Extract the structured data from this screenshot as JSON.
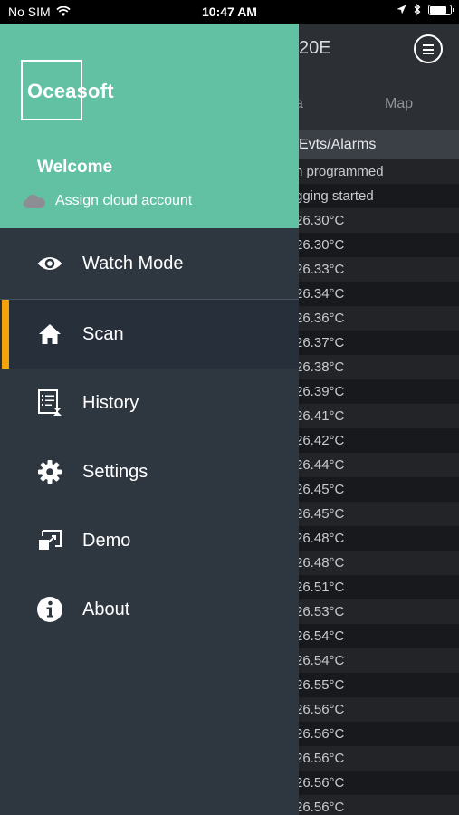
{
  "status_bar": {
    "carrier": "No SIM",
    "time": "10:47 AM",
    "battery_level": 0.85
  },
  "background_app": {
    "title_partial": "20E",
    "tabs": [
      "a",
      "Map"
    ],
    "column_header": "Evts/Alarms",
    "rows": [
      "n programmed",
      "gging started",
      "26.30°C",
      "26.30°C",
      "26.33°C",
      "26.34°C",
      "26.36°C",
      "26.37°C",
      "26.38°C",
      "26.39°C",
      "26.41°C",
      "26.42°C",
      "26.44°C",
      "26.45°C",
      "26.45°C",
      "26.48°C",
      "26.48°C",
      "26.51°C",
      "26.53°C",
      "26.54°C",
      "26.54°C",
      "26.55°C",
      "26.56°C",
      "26.56°C",
      "26.56°C",
      "26.56°C",
      "26.56°C"
    ]
  },
  "drawer": {
    "logo": "Oceasoft",
    "welcome": "Welcome",
    "cloud_link": "Assign cloud account",
    "items": [
      {
        "label": "Watch Mode",
        "icon": "eye-icon"
      },
      {
        "label": "Scan",
        "icon": "home-icon",
        "active": true
      },
      {
        "label": "History",
        "icon": "history-icon"
      },
      {
        "label": "Settings",
        "icon": "gear-icon"
      },
      {
        "label": "Demo",
        "icon": "demo-icon"
      },
      {
        "label": "About",
        "icon": "info-icon"
      }
    ]
  },
  "colors": {
    "drawer_header": "#62c0a3",
    "drawer_bg": "#2e3640",
    "active_indicator": "#f4a30b"
  }
}
